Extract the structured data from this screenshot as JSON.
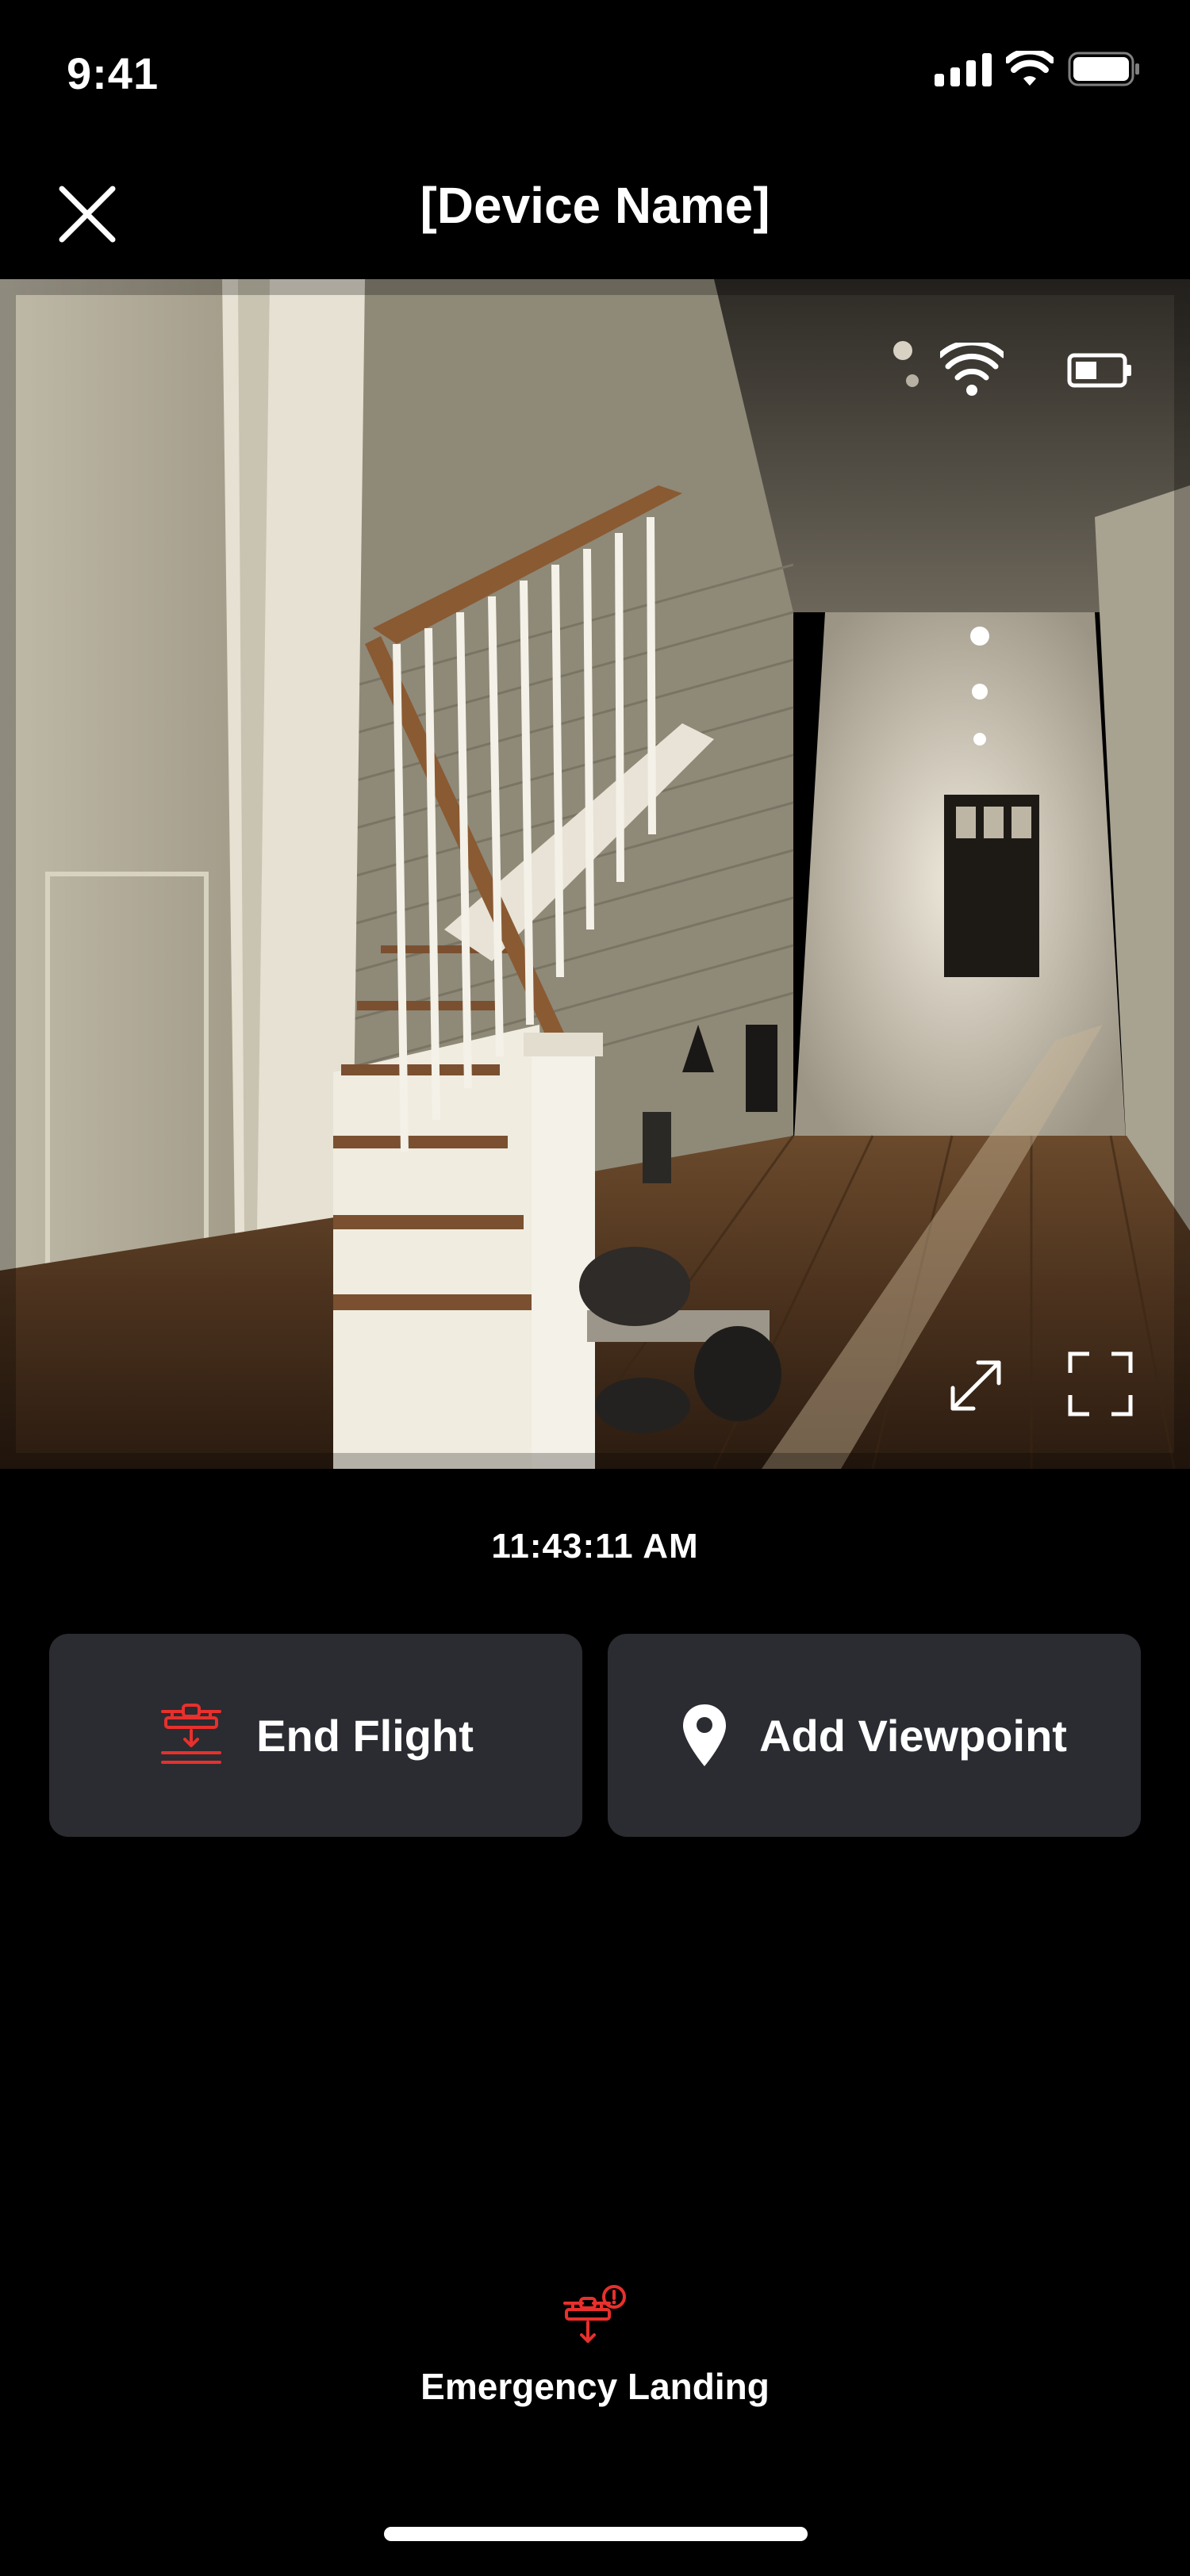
{
  "status_bar": {
    "time": "9:41",
    "icons": [
      "cellular-signal-icon",
      "wifi-icon",
      "battery-icon"
    ]
  },
  "header": {
    "title": "[Device Name]",
    "close_icon": "close-icon"
  },
  "camera_feed": {
    "overlay_icons": [
      "wifi-icon",
      "battery-low-icon",
      "expand-icon",
      "fullscreen-icon"
    ]
  },
  "timestamp": "11:43:11 AM",
  "actions": {
    "end_flight": {
      "label": "End Flight",
      "icon": "drone-land-icon"
    },
    "add_viewpoint": {
      "label": "Add Viewpoint",
      "icon": "location-pin-icon"
    }
  },
  "emergency": {
    "label": "Emergency Landing",
    "icon": "drone-emergency-icon"
  },
  "colors": {
    "background": "#000000",
    "button_background": "#2a2c31",
    "accent_red": "#e8302c",
    "text": "#ffffff"
  }
}
